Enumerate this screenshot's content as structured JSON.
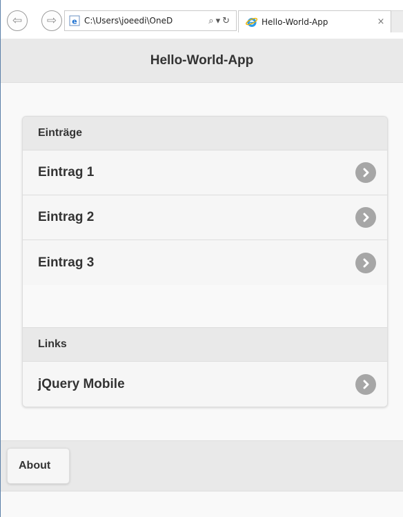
{
  "browser": {
    "back_icon": "back-arrow-icon",
    "forward_icon": "forward-arrow-icon",
    "address": "C:\\Users\\joeedi\\OneD",
    "search_icon": "search-icon",
    "dropdown_icon": "chevron-down-icon",
    "refresh_icon": "refresh-icon",
    "tab_title": "Hello-World-App",
    "tab_close": "×"
  },
  "header": {
    "title": "Hello-World-App"
  },
  "list": {
    "entries_divider": "Einträge",
    "entries": [
      {
        "label": "Eintrag 1"
      },
      {
        "label": "Eintrag 2"
      },
      {
        "label": "Eintrag 3"
      }
    ],
    "links_divider": "Links",
    "links": [
      {
        "label": "jQuery Mobile"
      }
    ]
  },
  "footer": {
    "about_label": "About"
  },
  "colors": {
    "header_bg": "#e9e9e9",
    "item_bg": "#f6f6f6",
    "arrow_bg": "#a6a6a6",
    "text": "#333333"
  }
}
